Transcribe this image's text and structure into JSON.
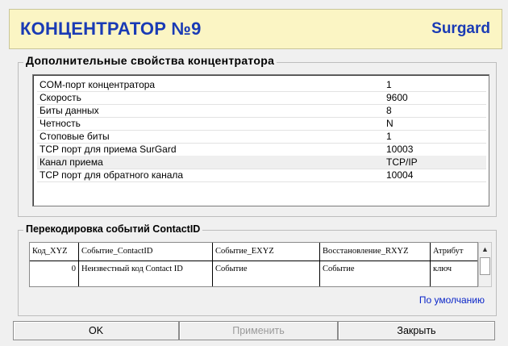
{
  "header": {
    "title": "КОНЦЕНТРАТОР №9",
    "brand": "Surgard"
  },
  "props": {
    "group_title": "Дополнительные свойства концентратора",
    "rows": [
      {
        "name": "COM-порт концентратора",
        "value": "1"
      },
      {
        "name": "Скорость",
        "value": "9600"
      },
      {
        "name": "Биты данных",
        "value": "8"
      },
      {
        "name": "Четность",
        "value": "N"
      },
      {
        "name": "Стоповые биты",
        "value": "1"
      },
      {
        "name": "TCP порт для приема SurGard",
        "value": "10003"
      },
      {
        "name": "Канал приема",
        "value": "TCP/IP"
      },
      {
        "name": "TCP порт для обратного канала",
        "value": "10004"
      }
    ]
  },
  "recode": {
    "group_title": "Перекодировка событий ContactID",
    "columns": [
      "Код_XYZ",
      "Событие_ContactID",
      "Событие_EXYZ",
      "Восстановление_RXYZ",
      "Атрибут"
    ],
    "rows": [
      {
        "code": "0",
        "event": "Неизвестный код Contact ID",
        "exyz": "Событие",
        "rxyz": "Событие",
        "attr": "ключ"
      }
    ],
    "default_link": "По умолчанию"
  },
  "buttons": {
    "ok": "OK",
    "apply": "Применить",
    "close": "Закрыть"
  }
}
